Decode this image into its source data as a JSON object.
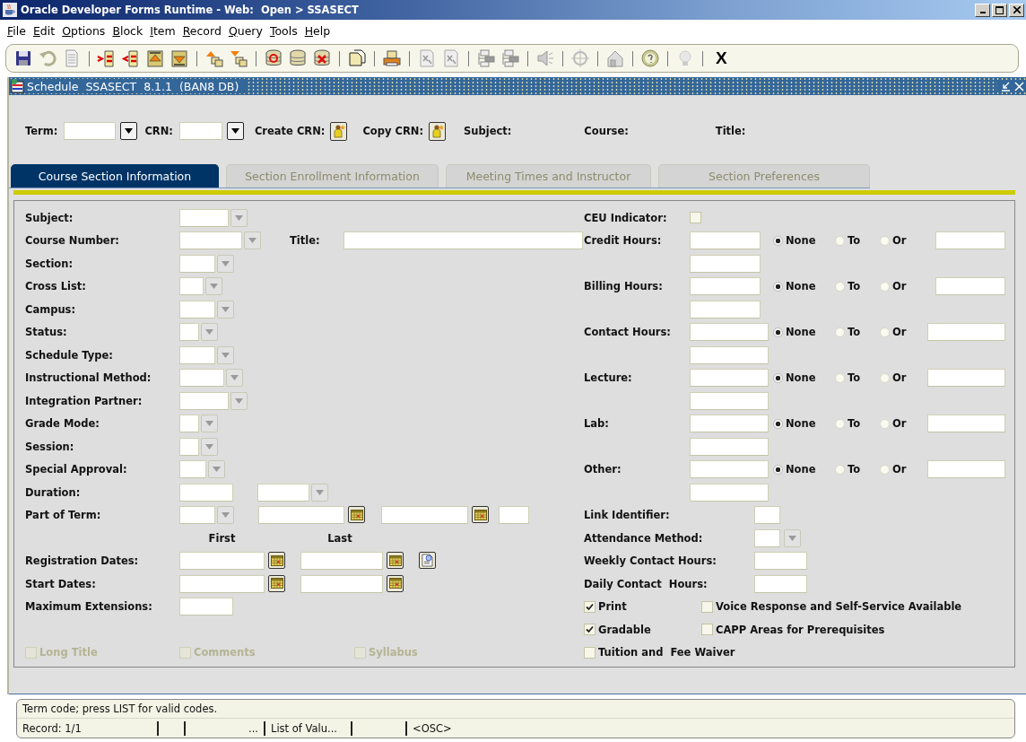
{
  "window": {
    "title": "Oracle Developer Forms Runtime - Web:  Open > SSASECT"
  },
  "menu": [
    "File",
    "Edit",
    "Options",
    "Block",
    "Item",
    "Record",
    "Query",
    "Tools",
    "Help"
  ],
  "toolbar": {
    "exit_label": "X"
  },
  "form": {
    "title": "Schedule  SSASECT  8.1.1  (BAN8 DB)"
  },
  "header": {
    "items": [
      {
        "kind": "lov",
        "label": "Term:"
      },
      {
        "kind": "lov",
        "label": "CRN:"
      },
      {
        "kind": "button",
        "label": "Create CRN:"
      },
      {
        "kind": "button",
        "label": "Copy CRN:"
      },
      {
        "kind": "display",
        "label": "Subject:"
      },
      {
        "kind": "display",
        "label": "Course:"
      },
      {
        "kind": "display",
        "label": "Title:"
      }
    ]
  },
  "tabs": [
    {
      "label": "Course Section Information",
      "selected": true
    },
    {
      "label": "Section Enrollment Information",
      "selected": false
    },
    {
      "label": "Meeting Times and Instructor",
      "selected": false
    },
    {
      "label": "Section Preferences",
      "selected": false
    }
  ],
  "left_rows": [
    {
      "kind": "field",
      "label": "Subject:",
      "controls": [
        {
          "kind": "text"
        },
        {
          "kind": "lov"
        }
      ]
    },
    {
      "kind": "field",
      "label": "Course Number:",
      "controls": [
        {
          "kind": "text"
        },
        {
          "kind": "lov"
        },
        {
          "kind": "caption",
          "text": "Title:"
        },
        {
          "kind": "text"
        }
      ]
    },
    {
      "kind": "field",
      "label": "Section:",
      "controls": [
        {
          "kind": "text"
        },
        {
          "kind": "lov"
        }
      ]
    },
    {
      "kind": "field",
      "label": "Cross List:",
      "controls": [
        {
          "kind": "text"
        },
        {
          "kind": "lov"
        }
      ]
    },
    {
      "kind": "field",
      "label": "Campus:",
      "controls": [
        {
          "kind": "text"
        },
        {
          "kind": "lov"
        }
      ]
    },
    {
      "kind": "field",
      "label": "Status:",
      "controls": [
        {
          "kind": "text"
        },
        {
          "kind": "lov"
        }
      ]
    },
    {
      "kind": "field",
      "label": "Schedule Type:",
      "controls": [
        {
          "kind": "text"
        },
        {
          "kind": "lov"
        }
      ]
    },
    {
      "kind": "field",
      "label": "Instructional Method:",
      "controls": [
        {
          "kind": "text"
        },
        {
          "kind": "lov"
        }
      ]
    },
    {
      "kind": "field",
      "label": "Integration Partner:",
      "controls": [
        {
          "kind": "text"
        },
        {
          "kind": "lov"
        }
      ]
    },
    {
      "kind": "field",
      "label": "Grade Mode:",
      "controls": [
        {
          "kind": "text"
        },
        {
          "kind": "lov"
        }
      ]
    },
    {
      "kind": "field",
      "label": "Session:",
      "controls": [
        {
          "kind": "text"
        },
        {
          "kind": "lov"
        }
      ]
    },
    {
      "kind": "field",
      "label": "Special Approval:",
      "controls": [
        {
          "kind": "text"
        },
        {
          "kind": "lov"
        }
      ]
    },
    {
      "kind": "field",
      "label": "Duration:",
      "controls": [
        {
          "kind": "text"
        },
        {
          "kind": "text"
        },
        {
          "kind": "lov"
        }
      ]
    },
    {
      "kind": "field",
      "label": "Part of Term:",
      "controls": [
        {
          "kind": "text"
        },
        {
          "kind": "lov"
        },
        {
          "kind": "date"
        },
        {
          "kind": "date"
        },
        {
          "kind": "text"
        }
      ]
    },
    {
      "kind": "columns",
      "columns": [
        "First",
        "Last"
      ]
    },
    {
      "kind": "field",
      "label": "Registration Dates:",
      "controls": [
        {
          "kind": "date"
        },
        {
          "kind": "date"
        },
        {
          "kind": "details"
        }
      ]
    },
    {
      "kind": "field",
      "label": "Start Dates:",
      "controls": [
        {
          "kind": "date"
        },
        {
          "kind": "date"
        }
      ]
    },
    {
      "kind": "field",
      "label": "Maximum Extensions:",
      "controls": [
        {
          "kind": "text"
        }
      ]
    },
    {
      "kind": "spacer"
    },
    {
      "kind": "checks",
      "items": [
        {
          "label": "Long Title",
          "checked": false,
          "disabled": true
        },
        {
          "label": "Comments",
          "checked": false,
          "disabled": true
        },
        {
          "label": "Syllabus",
          "checked": false,
          "disabled": true
        }
      ]
    }
  ],
  "right_rows": [
    {
      "kind": "check",
      "label": "CEU Indicator:",
      "checked": false
    },
    {
      "kind": "hours",
      "label": "Credit Hours:",
      "options": [
        {
          "label": "None",
          "selected": true
        },
        {
          "label": "To",
          "selected": false
        },
        {
          "label": "Or",
          "selected": false
        }
      ]
    },
    {
      "kind": "hours",
      "label": "Billing Hours:",
      "options": [
        {
          "label": "None",
          "selected": true
        },
        {
          "label": "To",
          "selected": false
        },
        {
          "label": "Or",
          "selected": false
        }
      ]
    },
    {
      "kind": "hours",
      "label": "Contact Hours:",
      "options": [
        {
          "label": "None",
          "selected": true
        },
        {
          "label": "To",
          "selected": false
        },
        {
          "label": "Or",
          "selected": false
        }
      ]
    },
    {
      "kind": "hours",
      "label": "Lecture:",
      "options": [
        {
          "label": "None",
          "selected": true
        },
        {
          "label": "To",
          "selected": false
        },
        {
          "label": "Or",
          "selected": false
        }
      ]
    },
    {
      "kind": "hours",
      "label": "Lab:",
      "options": [
        {
          "label": "None",
          "selected": true
        },
        {
          "label": "To",
          "selected": false
        },
        {
          "label": "Or",
          "selected": false
        }
      ]
    },
    {
      "kind": "hours",
      "label": "Other:",
      "options": [
        {
          "label": "None",
          "selected": true
        },
        {
          "label": "To",
          "selected": false
        },
        {
          "label": "Or",
          "selected": false
        }
      ]
    },
    {
      "kind": "field",
      "label": "Link Identifier:",
      "controls": [
        {
          "kind": "text"
        }
      ]
    },
    {
      "kind": "field",
      "label": "Attendance Method:",
      "controls": [
        {
          "kind": "text"
        },
        {
          "kind": "lov"
        }
      ]
    },
    {
      "kind": "field",
      "label": "Weekly Contact Hours:",
      "controls": [
        {
          "kind": "text"
        }
      ]
    },
    {
      "kind": "field",
      "label": "Daily Contact  Hours:",
      "controls": [
        {
          "kind": "text"
        }
      ]
    },
    {
      "kind": "checks",
      "items": [
        {
          "label": "Print",
          "checked": true,
          "disabled": false
        },
        {
          "label": "Voice Response and Self-Service Available",
          "checked": false,
          "disabled": false
        }
      ]
    },
    {
      "kind": "checks",
      "items": [
        {
          "label": "Gradable",
          "checked": true,
          "disabled": false
        },
        {
          "label": "CAPP Areas for Prerequisites",
          "checked": false,
          "disabled": false
        }
      ]
    },
    {
      "kind": "checks",
      "items": [
        {
          "label": "Tuition and  Fee Waiver",
          "checked": false,
          "disabled": false
        }
      ]
    }
  ],
  "status": {
    "message": "Term code; press LIST for valid codes.",
    "segments": [
      "Record: 1/1",
      "...",
      "List of Valu...",
      "<OSC>"
    ]
  }
}
